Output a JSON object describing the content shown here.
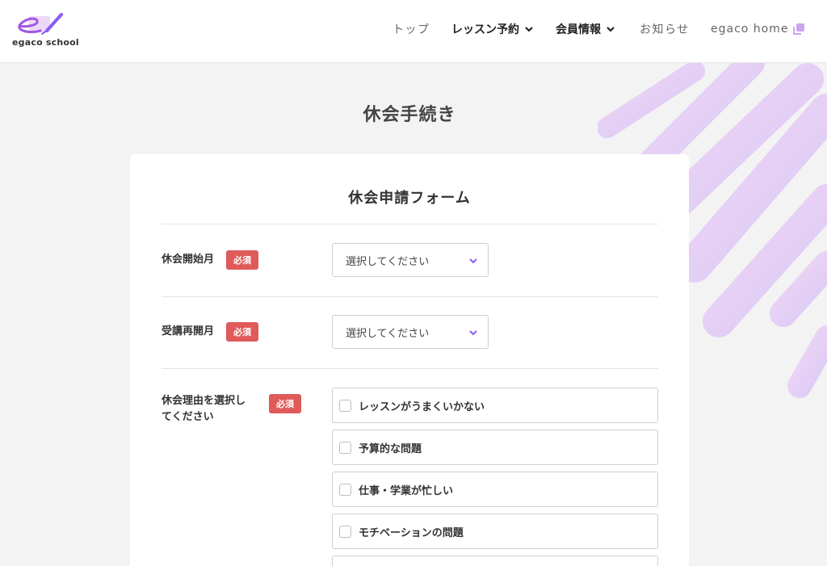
{
  "header": {
    "logo_text": "egaco school",
    "nav": [
      {
        "label": "トップ",
        "has_dropdown": false
      },
      {
        "label": "レッスン予約",
        "has_dropdown": true
      },
      {
        "label": "会員情報",
        "has_dropdown": true
      },
      {
        "label": "お知らせ",
        "has_dropdown": false
      },
      {
        "label": "egaco home",
        "has_external_icon": true
      }
    ]
  },
  "page": {
    "title": "休会手続き"
  },
  "form": {
    "title": "休会申請フォーム",
    "required_label": "必須",
    "fields": [
      {
        "label": "休会開始月",
        "placeholder": "選択してください"
      },
      {
        "label": "受講再開月",
        "placeholder": "選択してください"
      },
      {
        "label_line1": "休会理由を選択し",
        "label_line2": "てください"
      }
    ],
    "reasons": [
      "レッスンがうまくいかない",
      "予算的な問題",
      "仕事・学業が忙しい",
      "モチベーションの問題"
    ]
  },
  "colors": {
    "accent": "#8a5cf6",
    "badge": "#e05a5a",
    "background": "#f3f3f3"
  }
}
